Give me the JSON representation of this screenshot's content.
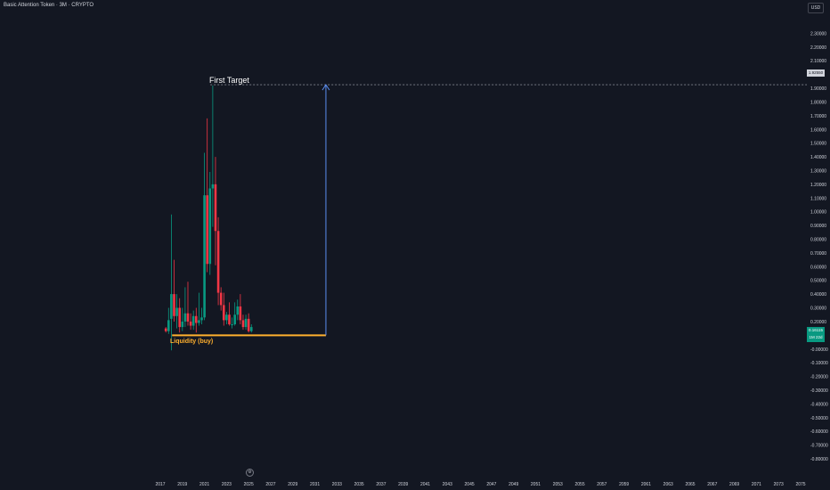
{
  "header": {
    "symbol_title": "Basic Attention Token · 3M · CRYPTO",
    "currency": "USD"
  },
  "annotations": {
    "target_label": "First Target",
    "liquidity_label": "Liquidity (buy)",
    "target_price": "1.92550",
    "current_price": "0.16115",
    "countdown": "1M 22d",
    "settings_icon": "gear-icon"
  },
  "colors": {
    "background": "#131722",
    "up": "#089981",
    "down": "#f23645",
    "liquidity_line": "#ffb02e",
    "target_arrow": "#5b8def"
  },
  "chart_data": {
    "type": "candlestick",
    "title": "Basic Attention Token · 3M · CRYPTO",
    "currency": "USD",
    "ylim": [
      -0.8,
      2.4
    ],
    "y_ticks": [
      "2.30000",
      "2.20000",
      "2.10000",
      "1.90000",
      "1.80000",
      "1.70000",
      "1.60000",
      "1.50000",
      "1.40000",
      "1.30000",
      "1.20000",
      "1.10000",
      "1.00000",
      "0.90000",
      "0.80000",
      "0.70000",
      "0.60000",
      "0.50000",
      "0.40000",
      "0.30000",
      "0.20000",
      "-0.00000",
      "-0.10000",
      "-0.20000",
      "-0.30000",
      "-0.40000",
      "-0.50000",
      "-0.60000",
      "-0.70000",
      "-0.80000"
    ],
    "x_ticks": [
      "2017",
      "2019",
      "2021",
      "2023",
      "2025",
      "2027",
      "2029",
      "2031",
      "2033",
      "2035",
      "2037",
      "2039",
      "2041",
      "2043",
      "2045",
      "2047",
      "2049",
      "2051",
      "2053",
      "2055",
      "2057",
      "2059",
      "2061",
      "2063",
      "2065",
      "2067",
      "2069",
      "2071",
      "2073",
      "2075"
    ],
    "x_range": [
      2017.0,
      2075.0
    ],
    "grid": false,
    "candles": [
      {
        "t": 2017.5,
        "o": 0.15,
        "h": 0.16,
        "l": 0.12,
        "c": 0.13
      },
      {
        "t": 2017.75,
        "o": 0.13,
        "h": 0.3,
        "l": 0.11,
        "c": 0.21
      },
      {
        "t": 2018.0,
        "o": 0.22,
        "h": 0.98,
        "l": -0.01,
        "c": 0.4
      },
      {
        "t": 2018.25,
        "o": 0.4,
        "h": 0.65,
        "l": 0.2,
        "c": 0.24
      },
      {
        "t": 2018.5,
        "o": 0.24,
        "h": 0.4,
        "l": 0.15,
        "c": 0.3
      },
      {
        "t": 2018.75,
        "o": 0.3,
        "h": 0.37,
        "l": 0.12,
        "c": 0.16
      },
      {
        "t": 2019.0,
        "o": 0.16,
        "h": 0.3,
        "l": 0.13,
        "c": 0.2
      },
      {
        "t": 2019.25,
        "o": 0.2,
        "h": 0.45,
        "l": 0.16,
        "c": 0.26
      },
      {
        "t": 2019.5,
        "o": 0.26,
        "h": 0.49,
        "l": 0.17,
        "c": 0.2
      },
      {
        "t": 2019.75,
        "o": 0.2,
        "h": 0.26,
        "l": 0.14,
        "c": 0.17
      },
      {
        "t": 2020.0,
        "o": 0.17,
        "h": 0.28,
        "l": 0.14,
        "c": 0.24
      },
      {
        "t": 2020.25,
        "o": 0.24,
        "h": 0.3,
        "l": 0.12,
        "c": 0.19
      },
      {
        "t": 2020.5,
        "o": 0.19,
        "h": 0.41,
        "l": 0.17,
        "c": 0.21
      },
      {
        "t": 2020.75,
        "o": 0.21,
        "h": 0.3,
        "l": 0.18,
        "c": 0.23
      },
      {
        "t": 2021.0,
        "o": 0.23,
        "h": 1.43,
        "l": 0.21,
        "c": 1.12
      },
      {
        "t": 2021.25,
        "o": 1.12,
        "h": 1.68,
        "l": 0.56,
        "c": 0.62
      },
      {
        "t": 2021.5,
        "o": 0.62,
        "h": 1.29,
        "l": 0.54,
        "c": 1.17
      },
      {
        "t": 2021.75,
        "o": 1.17,
        "h": 1.92,
        "l": 0.89,
        "c": 1.2
      },
      {
        "t": 2022.0,
        "o": 1.2,
        "h": 1.4,
        "l": 0.61,
        "c": 0.86
      },
      {
        "t": 2022.25,
        "o": 0.86,
        "h": 0.96,
        "l": 0.32,
        "c": 0.41
      },
      {
        "t": 2022.5,
        "o": 0.41,
        "h": 0.45,
        "l": 0.28,
        "c": 0.32
      },
      {
        "t": 2022.75,
        "o": 0.32,
        "h": 0.41,
        "l": 0.17,
        "c": 0.21
      },
      {
        "t": 2023.0,
        "o": 0.21,
        "h": 0.27,
        "l": 0.18,
        "c": 0.25
      },
      {
        "t": 2023.25,
        "o": 0.25,
        "h": 0.34,
        "l": 0.17,
        "c": 0.18
      },
      {
        "t": 2023.5,
        "o": 0.18,
        "h": 0.23,
        "l": 0.15,
        "c": 0.18
      },
      {
        "t": 2023.75,
        "o": 0.18,
        "h": 0.34,
        "l": 0.17,
        "c": 0.25
      },
      {
        "t": 2024.0,
        "o": 0.25,
        "h": 0.36,
        "l": 0.21,
        "c": 0.31
      },
      {
        "t": 2024.25,
        "o": 0.31,
        "h": 0.4,
        "l": 0.18,
        "c": 0.21
      },
      {
        "t": 2024.5,
        "o": 0.21,
        "h": 0.25,
        "l": 0.14,
        "c": 0.16
      },
      {
        "t": 2024.75,
        "o": 0.16,
        "h": 0.25,
        "l": 0.14,
        "c": 0.22
      },
      {
        "t": 2025.0,
        "o": 0.22,
        "h": 0.26,
        "l": 0.12,
        "c": 0.13
      },
      {
        "t": 2025.25,
        "o": 0.13,
        "h": 0.18,
        "l": 0.12,
        "c": 0.16
      }
    ],
    "target_level": 1.9255,
    "liquidity_level": 0.1,
    "liquidity_range": [
      2017.5,
      2032.0
    ],
    "arrow": {
      "x": 2032.0,
      "from": 0.1,
      "to": 1.9255
    }
  }
}
